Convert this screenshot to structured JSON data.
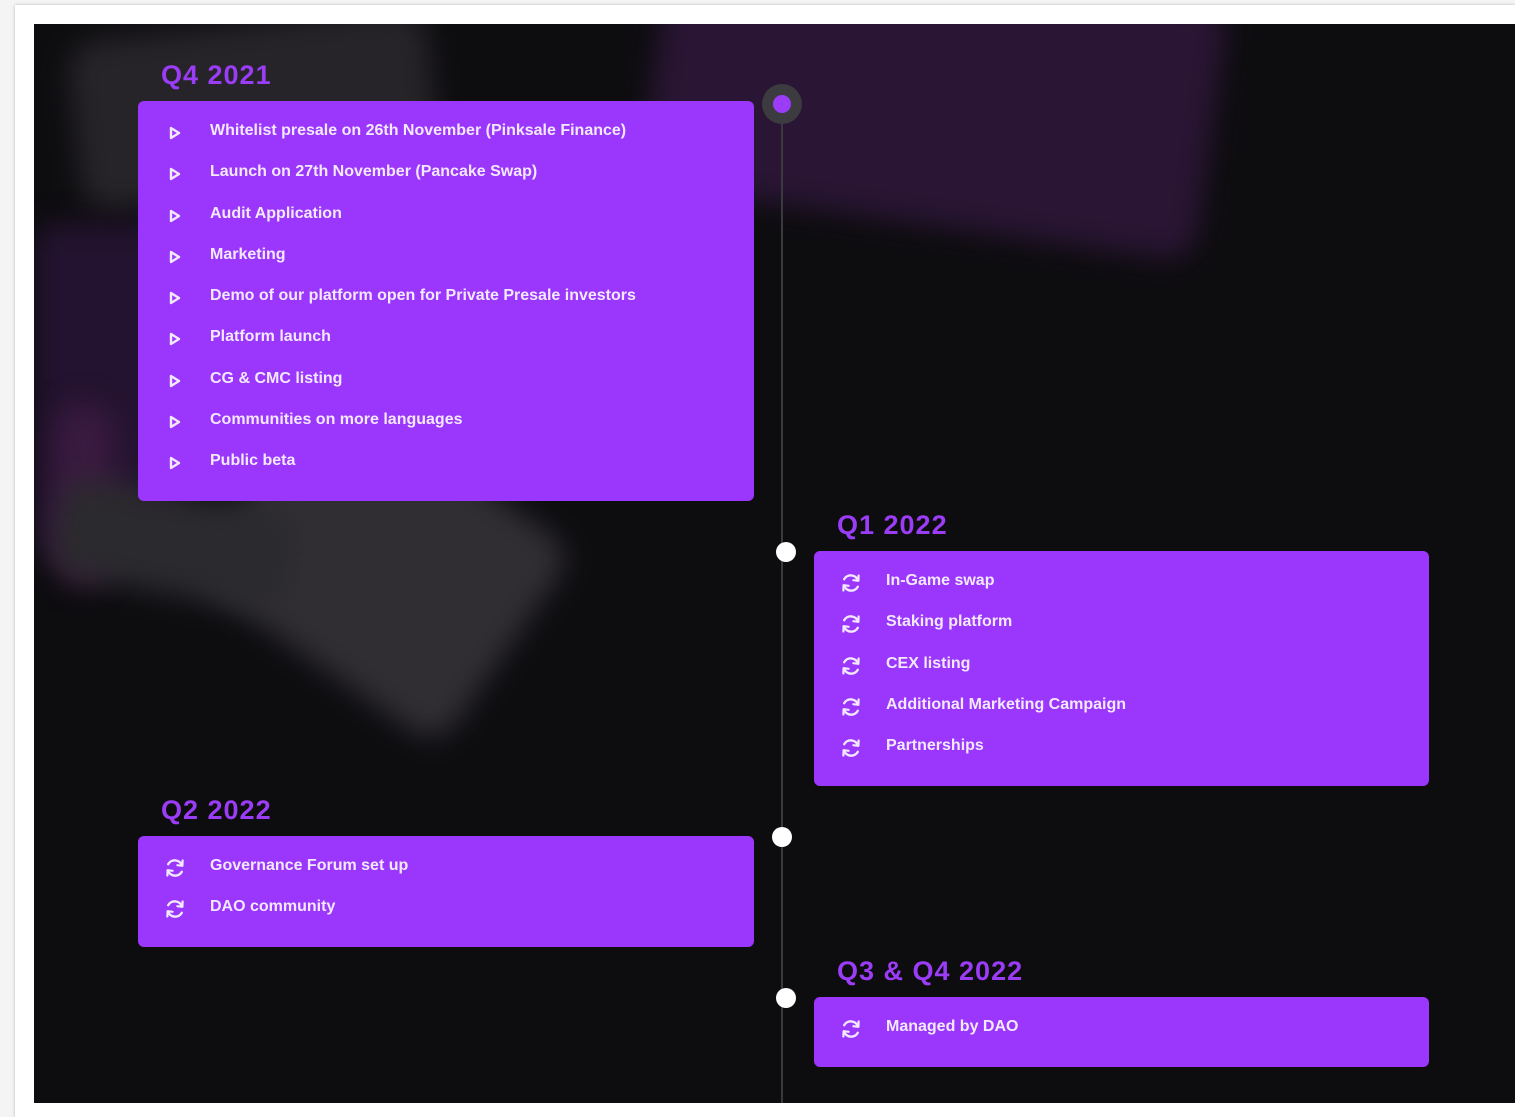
{
  "roadmap": [
    {
      "title": "Q4 2021",
      "icon": "play-triangle-icon",
      "items": [
        "Whitelist presale on 26th November (Pinksale Finance)",
        "Launch on 27th November (Pancake Swap)",
        "Audit Application",
        "Marketing",
        "Demo of our platform open for Private Presale investors",
        "Platform launch",
        "CG & CMC listing",
        "Communities on more languages",
        "Public beta"
      ]
    },
    {
      "title": "Q1 2022",
      "icon": "refresh-icon",
      "items": [
        "In-Game swap",
        "Staking platform",
        "CEX listing",
        "Additional Marketing Campaign",
        "Partnerships"
      ]
    },
    {
      "title": "Q2 2022",
      "icon": "refresh-icon",
      "items": [
        "Governance Forum set up",
        "DAO community"
      ]
    },
    {
      "title": "Q3 & Q4 2022",
      "icon": "refresh-icon",
      "items": [
        "Managed by DAO"
      ]
    }
  ],
  "colors": {
    "accent": "#9b3cf7",
    "card": "#9b37fc",
    "background": "#0d0c0f",
    "node": "#ffffff"
  }
}
